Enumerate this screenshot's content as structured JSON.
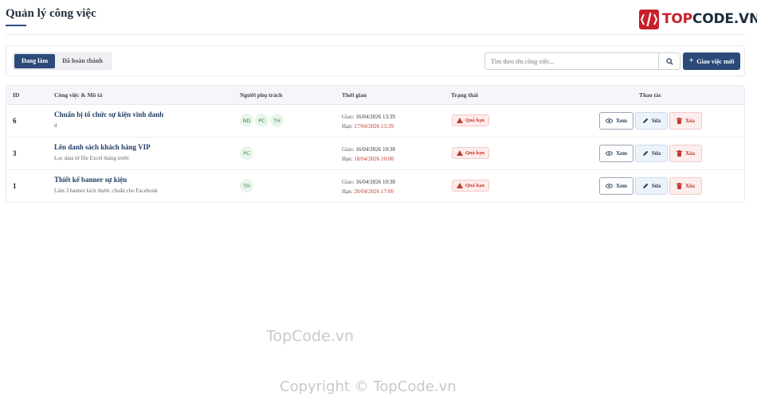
{
  "page": {
    "title": "Quản lý công việc"
  },
  "logo": {
    "brand": "TOPCODE.VN",
    "brand_accent": "TOP",
    "brand_rest": "CODE.VN",
    "color": "#c8202a"
  },
  "tabs": [
    {
      "label": "Đang làm",
      "active": true
    },
    {
      "label": "Đã hoàn thành",
      "active": false
    }
  ],
  "search": {
    "placeholder": "Tìm theo tên công việc...",
    "value": "",
    "icon": "search-icon"
  },
  "add_button": {
    "label": "Giao việc mới",
    "icon": "plus-icon"
  },
  "table": {
    "headers": {
      "id": "ID",
      "task": "Công việc & Mô tả",
      "assignee": "Người phụ trách",
      "time": "Thời gian",
      "status": "Trạng thái",
      "actions": "Thao tác"
    },
    "rows": [
      {
        "id": "6",
        "title": "Chuẩn bị tổ chức sự kiện vinh danh",
        "desc": "d",
        "assignees": [
          "ND",
          "PC",
          "TH"
        ],
        "assigned_label": "Giao:",
        "assigned": "16/04/2026 13:39",
        "due_label": "Hạn:",
        "due": "17/04/2026 13:39",
        "status": "Quá hạn"
      },
      {
        "id": "3",
        "title": "Lên danh sách khách hàng VIP",
        "desc": "Lọc data từ file Excel tháng trước",
        "assignees": [
          "PC"
        ],
        "assigned_label": "Giao:",
        "assigned": "16/04/2026 10:38",
        "due_label": "Hạn:",
        "due": "18/04/2026 10:00",
        "status": "Quá hạn"
      },
      {
        "id": "1",
        "title": "Thiết kế banner sự kiện",
        "desc": "Làm 3 banner kích thước chuẩn cho Facebook",
        "assignees": [
          "TH"
        ],
        "assigned_label": "Giao:",
        "assigned": "16/04/2026 10:38",
        "due_label": "Hạn:",
        "due": "20/04/2026 17:00",
        "status": "Quá hạn"
      }
    ],
    "actions": {
      "view": "Xem",
      "edit": "Sửa",
      "delete": "Xóa"
    }
  },
  "watermarks": {
    "center": "TopCode.vn",
    "copyright": "Copyright © TopCode.vn"
  },
  "colors": {
    "primary": "#2b4a78",
    "danger": "#c0392b",
    "avatar_bg": "#e8f5ea"
  }
}
